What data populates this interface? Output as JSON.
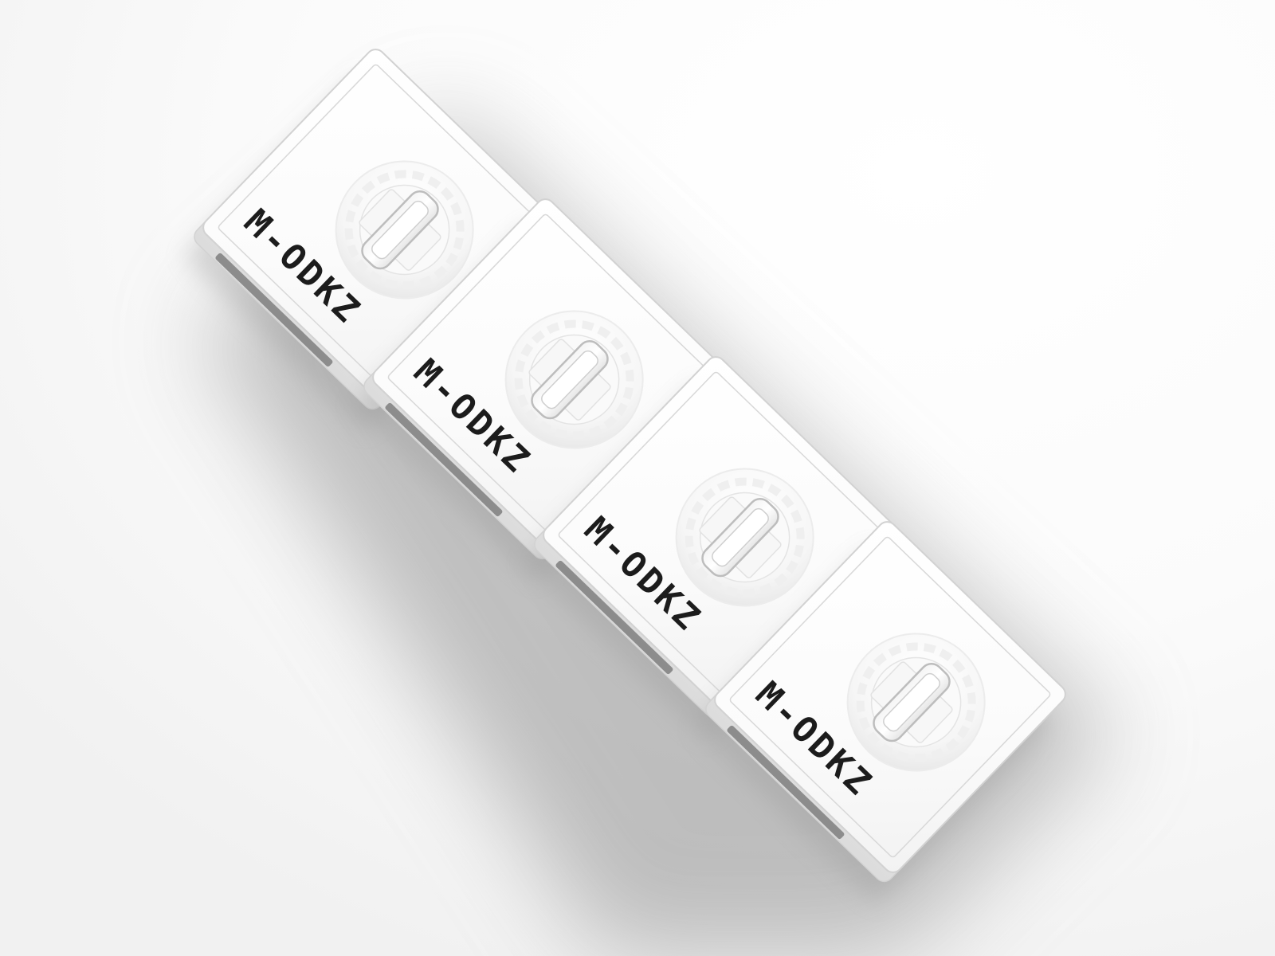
{
  "modules": [
    {
      "label": "M-ODKZ"
    },
    {
      "label": "M-ODKZ"
    },
    {
      "label": "M-ODKZ"
    },
    {
      "label": "M-ODKZ"
    }
  ],
  "colors": {
    "background": "#ffffff",
    "module_face": "#fdfdfd",
    "module_side": "#e9e9e9",
    "module_edge": "#d2d2d2",
    "shadow": "#9a9a9a",
    "label_text": "#1c1c1c"
  },
  "icons": {
    "knob": "rotary-knob-icon",
    "grip": "grip-handle-icon"
  }
}
